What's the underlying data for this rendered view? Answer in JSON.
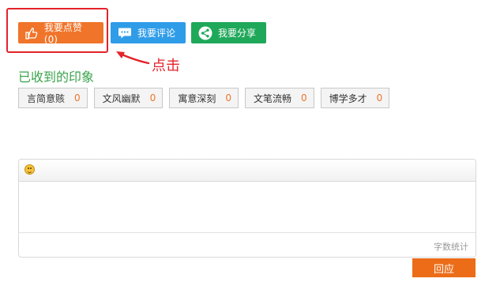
{
  "actions": {
    "like_label": "我要点赞 (0)",
    "comment_label": "我要评论",
    "share_label": "我要分享"
  },
  "annotation": {
    "text": "点击",
    "color": "#e4232a"
  },
  "impressions": {
    "title": "已收到的印象",
    "tags": [
      {
        "label": "言简意赅",
        "count": "0"
      },
      {
        "label": "文风幽默",
        "count": "0"
      },
      {
        "label": "寓意深刻",
        "count": "0"
      },
      {
        "label": "文笔流畅",
        "count": "0"
      },
      {
        "label": "博学多才",
        "count": "0"
      }
    ]
  },
  "editor": {
    "value": "",
    "word_count_label": "字数统计"
  },
  "reply_label": "回应",
  "colors": {
    "like": "#f0742a",
    "comment": "#2f9ce8",
    "share": "#1fa85a",
    "impression_title": "#3aa34b",
    "tag_count": "#f0742a",
    "reply": "#ec6c18"
  },
  "icons": {
    "like": "thumbs-up-icon",
    "comment": "speech-bubble-icon",
    "share": "share-icon",
    "emoji": "smiley-icon"
  }
}
